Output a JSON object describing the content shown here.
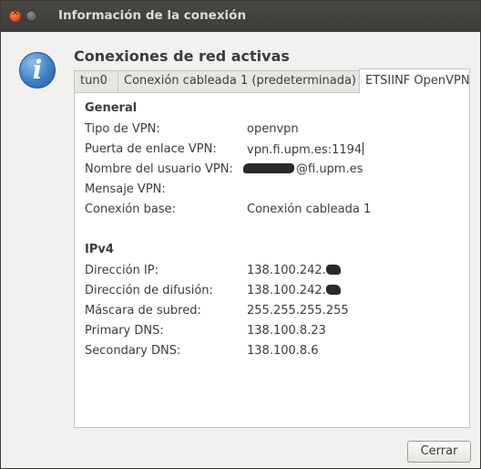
{
  "window": {
    "title": "Información de la conexión",
    "icon": "info-icon",
    "heading": "Conexiones de red activas"
  },
  "tabs": [
    {
      "label": "tun0",
      "active": false
    },
    {
      "label": "Conexión cableada 1 (predeterminada)",
      "active": false
    },
    {
      "label": "ETSIINF OpenVPN",
      "active": true
    }
  ],
  "general": {
    "heading": "General",
    "rows": [
      {
        "label": "Tipo de VPN:",
        "value": "openvpn"
      },
      {
        "label": "Puerta de enlace VPN:",
        "value": "vpn.fi.upm.es:1194"
      },
      {
        "label": "Nombre del usuario VPN:",
        "value": "@fi.upm.es"
      },
      {
        "label": "Mensaje VPN:",
        "value": ""
      },
      {
        "label": "Conexión base:",
        "value": "Conexión cableada 1"
      }
    ]
  },
  "ipv4": {
    "heading": "IPv4",
    "rows": [
      {
        "label": "Dirección IP:",
        "value": "138.100.242."
      },
      {
        "label": "Dirección de difusión:",
        "value": "138.100.242."
      },
      {
        "label": "Máscara de subred:",
        "value": "255.255.255.255"
      },
      {
        "label": "Primary DNS:",
        "value": "138.100.8.23"
      },
      {
        "label": "Secondary DNS:",
        "value": "138.100.8.6"
      }
    ]
  },
  "buttons": {
    "close_label": "Cerrar"
  },
  "colors": {
    "titlebar": "#3c3b37",
    "window_bg": "#f2f1f0",
    "close_button": "#e0531f"
  }
}
